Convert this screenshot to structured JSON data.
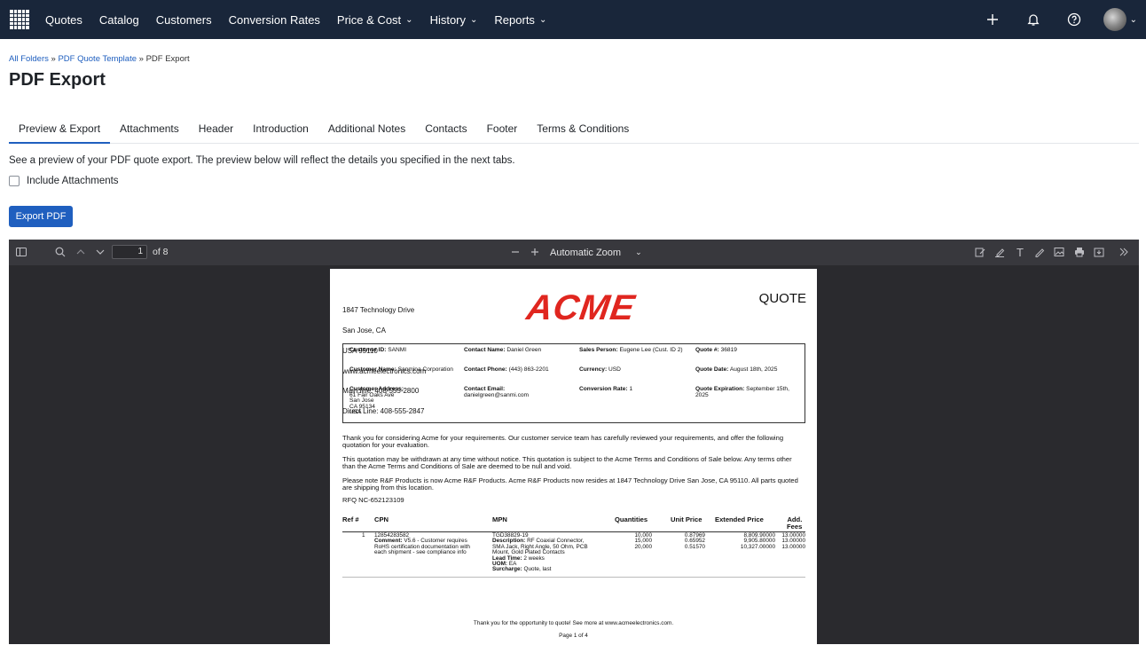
{
  "nav": {
    "items": [
      "Quotes",
      "Catalog",
      "Customers",
      "Conversion Rates",
      "Price & Cost",
      "History",
      "Reports"
    ],
    "dropdown_items": [
      "Price & Cost",
      "History",
      "Reports"
    ],
    "icons": [
      "plus-icon",
      "bell-icon",
      "help-icon",
      "avatar"
    ]
  },
  "breadcrumb": {
    "folder1": "All Folders",
    "sep": "»",
    "folder2": "PDF Quote Template",
    "current": "PDF Export"
  },
  "page_title": "PDF Export",
  "tabs": [
    "Preview & Export",
    "Attachments",
    "Header",
    "Introduction",
    "Additional Notes",
    "Contacts",
    "Footer",
    "Terms & Conditions"
  ],
  "description": "See a preview of your PDF quote export. The preview below will reflect the details you specified in the next tabs.",
  "include_attachments_label": "Include Attachments",
  "export_button_label": "Export PDF",
  "viewer": {
    "page_number": "1",
    "page_count": "of 8",
    "zoom": "Automatic Zoom"
  },
  "pdf": {
    "address": [
      "1847 Technology Drive",
      "San Jose, CA",
      "USA 95110",
      "www.acmeelectronics.com",
      "Main line: 408-555-2800",
      "Direct Line: 408-555-2847"
    ],
    "logo": "ACME",
    "doc_title": "QUOTE",
    "customer_id_label": "Customer ID:",
    "customer_id": "SANMI",
    "contact_name_label": "Contact Name:",
    "contact_name": "Daniel Green",
    "sales_person_label": "Sales Person:",
    "sales_person": "Eugene Lee (Cust. ID 2)",
    "quote_no_label": "Quote #:",
    "quote_no": "36819",
    "customer_name_label": "Customer Name:",
    "customer_name": "Sanmina Corporation",
    "contact_phone_label": "Contact Phone:",
    "contact_phone": "(443) 863-2201",
    "currency_label": "Currency:",
    "currency": "USD",
    "quote_date_label": "Quote Date:",
    "quote_date": "August 18th, 2025",
    "customer_address_label": "Customer Address:",
    "customer_address": [
      "61 Fair Oaks Ave",
      "San Jose",
      "CA 95134",
      "USA"
    ],
    "contact_email_label": "Contact Email:",
    "contact_email": "danielgreen@sanmi.com",
    "conversion_rate_label": "Conversion Rate:",
    "conversion_rate": "1",
    "quote_expiration_label": "Quote Expiration:",
    "quote_expiration": "September 15th, 2025",
    "para1": "Thank you for considering Acme for your requirements. Our customer service team has carefully reviewed your requirements, and offer the following quotation for your evaluation.",
    "para2": "This quotation may be withdrawn at any time without notice. This quotation is subject to the Acme Terms and Conditions of Sale below. Any terms other than the Acme Terms and Conditions of Sale are deemed to be null and void.",
    "para3": "Please note R&F Products is now Acme R&F Products. Acme R&F Products now resides at 1847 Technology Drive San Jose, CA 95110. All parts quoted are shipping from this location.",
    "rfq": "RFQ NC-652123109",
    "table_headers": {
      "ref": "Ref #",
      "cpn": "CPN",
      "mpn": "MPN",
      "quantities": "Quantities",
      "unit_price": "Unit Price",
      "extended_price": "Extended Price",
      "add_fees_1": "Add.",
      "add_fees_2": "Fees"
    },
    "line_item": {
      "ref": "1",
      "cpn": "12854283582",
      "comment_label": "Comment:",
      "comment": [
        "V5.6 - Customer requires",
        "RoHS certification documentation with",
        "each shipment - see compliance info"
      ],
      "mpn": "TGD38829-19",
      "description_label": "Description:",
      "description": [
        "RF Coaxial Connector,",
        "SMA Jack, Right Angle, 50 Ohm, PCB",
        "Mount, Gold Plated Contacts"
      ],
      "lead_time_label": "Lead Time:",
      "lead_time": "2 weeks",
      "uom_label": "UOM:",
      "uom": "EA",
      "surcharge_label": "Surcharge:",
      "surcharge": "Quote, last",
      "quantities": [
        "10,000",
        "15,000",
        "20,000"
      ],
      "unit_prices": [
        "0.87969",
        "0.65952",
        "0.51570"
      ],
      "extended_prices": [
        "8,809.90000",
        "9,905.80000",
        "10,327.00000"
      ],
      "add_fees": [
        "13.00000",
        "13.00000",
        "13.00000"
      ]
    },
    "footer_text": "Thank you for the opportunity to quote! See more at www.acmeelectronics.com.",
    "footer_page": "Page 1 of 4"
  }
}
